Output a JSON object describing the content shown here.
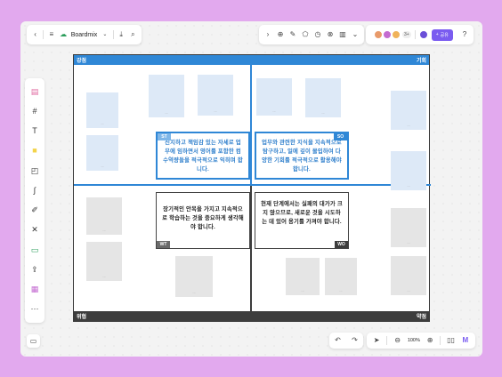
{
  "toolbar_left": {
    "back_icon": "chevron-left-icon",
    "menu_icon": "hamburger-icon",
    "cloud_icon": "cloud-icon",
    "board_name": "Boardmix",
    "dropdown_icon": "chevron-down-icon"
  },
  "toolbar_users": {
    "online_count": "3+",
    "share_label": "공유"
  },
  "board": {
    "quadrant_top_left": "강점",
    "quadrant_top_right": "기회",
    "quadrant_bottom_left": "위협",
    "quadrant_bottom_right": "약점",
    "cards": {
      "st": {
        "tag": "ST",
        "text": "진지하고 책임감 있는 자세로 업무에 임하면서 영어를 포함한 컴 수역량들을 적극적으로 익히며 합니다."
      },
      "so": {
        "tag": "SO",
        "text": "업무와 관련한 지식을 지속적으로 탐구하고, 일에 깊이 몰입하여 다양한 기회를 적극적으로 활용해야 합니다."
      },
      "wt": {
        "tag": "WT",
        "text": "장기적인 안목을 가지고 지속적으로 학습하는 것을 중요하게 생각해야 합니다."
      },
      "wo": {
        "tag": "WO",
        "text": "현재 단계에서는 실패의 대가가 크지 않으므로, 새로운 것을 시도하는 데 있어 용기를 가져야 합니다."
      }
    }
  },
  "zoom": {
    "level": "100%"
  },
  "colors": {
    "background": "#e2a9ee",
    "accent_blue": "#2f87d6",
    "dark": "#3d3d3d",
    "share": "#7a5cf0"
  }
}
